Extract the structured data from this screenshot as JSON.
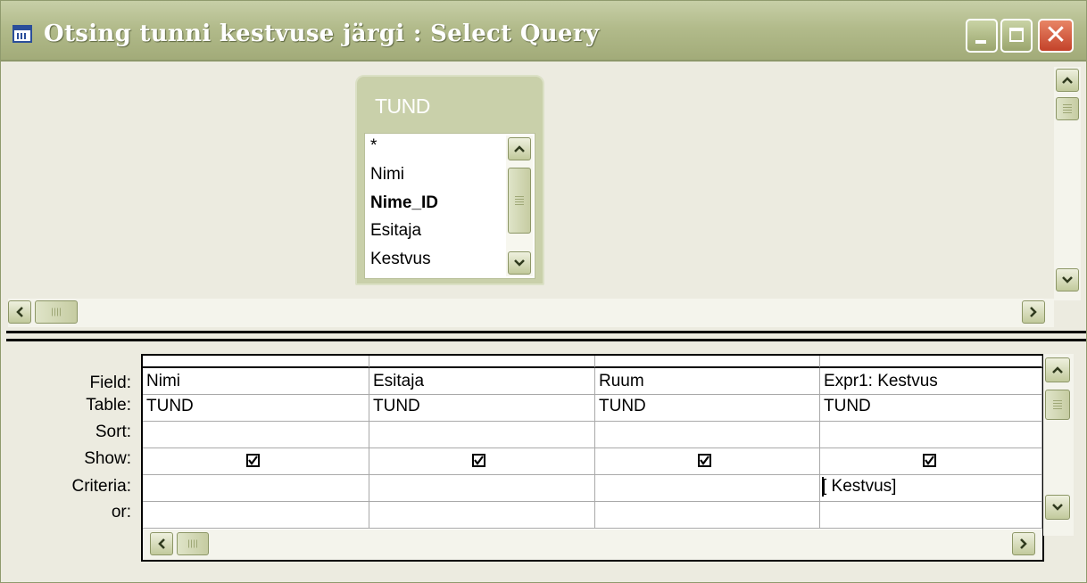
{
  "window": {
    "title": "Otsing tunni kestvuse järgi : Select Query",
    "icons": {
      "app": "query-window-icon",
      "minimize": "minimize-icon",
      "maximize": "maximize-icon",
      "close": "close-icon"
    },
    "close_glyph": "✕"
  },
  "table_box": {
    "title": "TUND",
    "fields": [
      "*",
      "Nimi",
      "Nime_ID",
      "Esitaja",
      "Kestvus"
    ],
    "primary_key": "Nime_ID"
  },
  "grid": {
    "row_labels": [
      "Field:",
      "Table:",
      "Sort:",
      "Show:",
      "Criteria:",
      "or:"
    ],
    "columns": [
      {
        "field": "Nimi",
        "table": "TUND",
        "sort": "",
        "show": true,
        "criteria": "",
        "or": ""
      },
      {
        "field": "Esitaja",
        "table": "TUND",
        "sort": "",
        "show": true,
        "criteria": "",
        "or": ""
      },
      {
        "field": "Ruum",
        "table": "TUND",
        "sort": "",
        "show": true,
        "criteria": "",
        "or": ""
      },
      {
        "field": "Expr1: Kestvus",
        "table": "TUND",
        "sort": "",
        "show": true,
        "criteria": "[ Kestvus]",
        "or": ""
      }
    ]
  },
  "colors": {
    "titlebar": "#b2bb8b",
    "pane_bg": "#ecebe0",
    "close_button": "#c3422a"
  }
}
